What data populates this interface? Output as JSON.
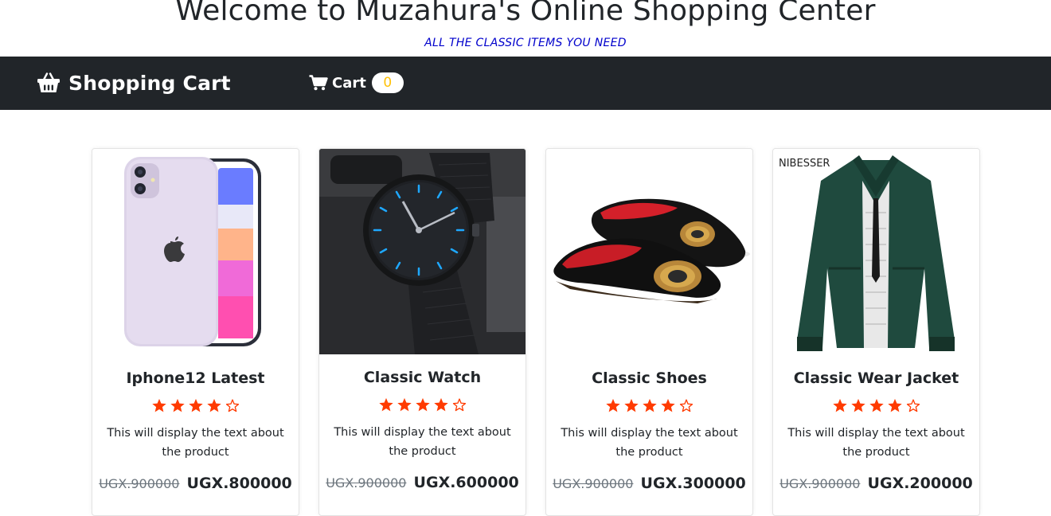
{
  "header": {
    "title": "Welcome to Muzahura's Online Shopping Center",
    "subtitle": "ALL THE CLASSIC ITEMS YOU NEED"
  },
  "navbar": {
    "brand_icon": "basket-icon",
    "brand": "Shopping Cart",
    "cart_icon": "cart-icon",
    "cart_label": "Cart",
    "cart_count": "0",
    "colors": {
      "background": "#212529",
      "badge_text": "#ffc107"
    }
  },
  "products": [
    {
      "title": "Iphone12 Latest",
      "rating": 4,
      "rating_max": 5,
      "description": "This will display the text about the product",
      "old_price": "UGX.900000",
      "price": "UGX.800000"
    },
    {
      "title": "Classic Watch",
      "rating": 4,
      "rating_max": 5,
      "description": "This will display the text about the product",
      "old_price": "UGX.900000",
      "price": "UGX.600000"
    },
    {
      "title": "Classic Shoes",
      "rating": 4,
      "rating_max": 5,
      "description": "This will display the text about the product",
      "old_price": "UGX.900000",
      "price": "UGX.300000"
    },
    {
      "title": "Classic Wear Jacket",
      "rating": 4,
      "rating_max": 5,
      "description": "This will display the text about the product",
      "old_price": "UGX.900000",
      "price": "UGX.200000",
      "image_text": "NIBESSER"
    }
  ],
  "colors": {
    "star": "#ff3b00",
    "subtitle": "#0000cc"
  }
}
